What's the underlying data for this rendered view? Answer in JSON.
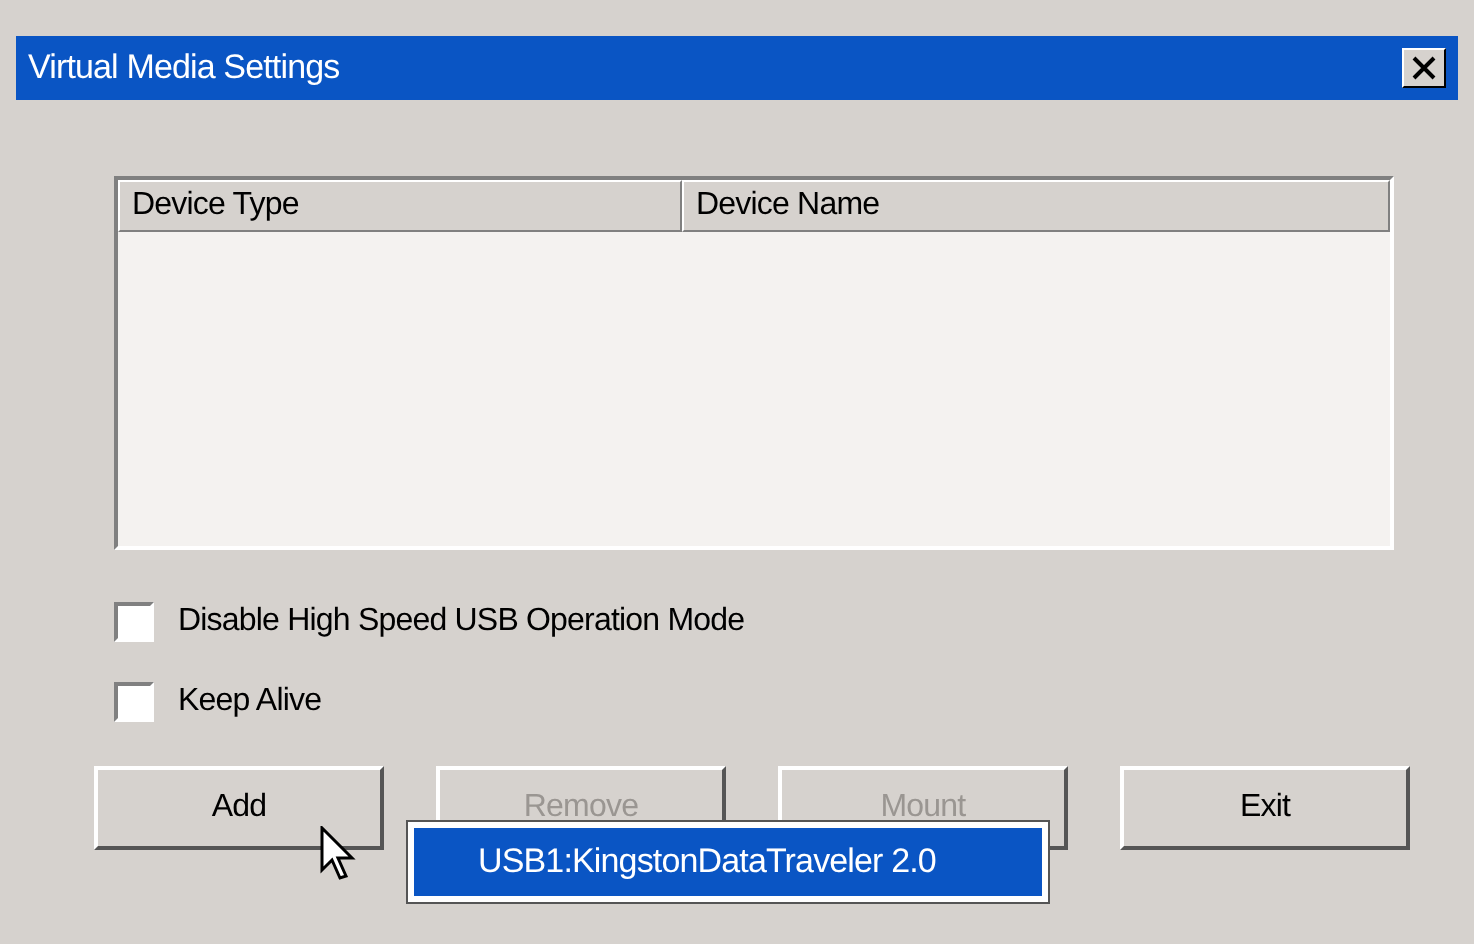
{
  "window": {
    "title": "Virtual Media Settings"
  },
  "table": {
    "columns": [
      "Device Type",
      "Device Name"
    ]
  },
  "options": [
    {
      "label": "Disable High Speed USB Operation Mode",
      "checked": false
    },
    {
      "label": "Keep Alive",
      "checked": false
    }
  ],
  "buttons": [
    {
      "label": "Add",
      "disabled": false
    },
    {
      "label": "Remove",
      "disabled": true
    },
    {
      "label": "Mount",
      "disabled": true
    },
    {
      "label": "Exit",
      "disabled": false
    }
  ],
  "popup": {
    "items": [
      {
        "label": "USB1:KingstonDataTraveler 2.0",
        "selected": true
      }
    ]
  }
}
